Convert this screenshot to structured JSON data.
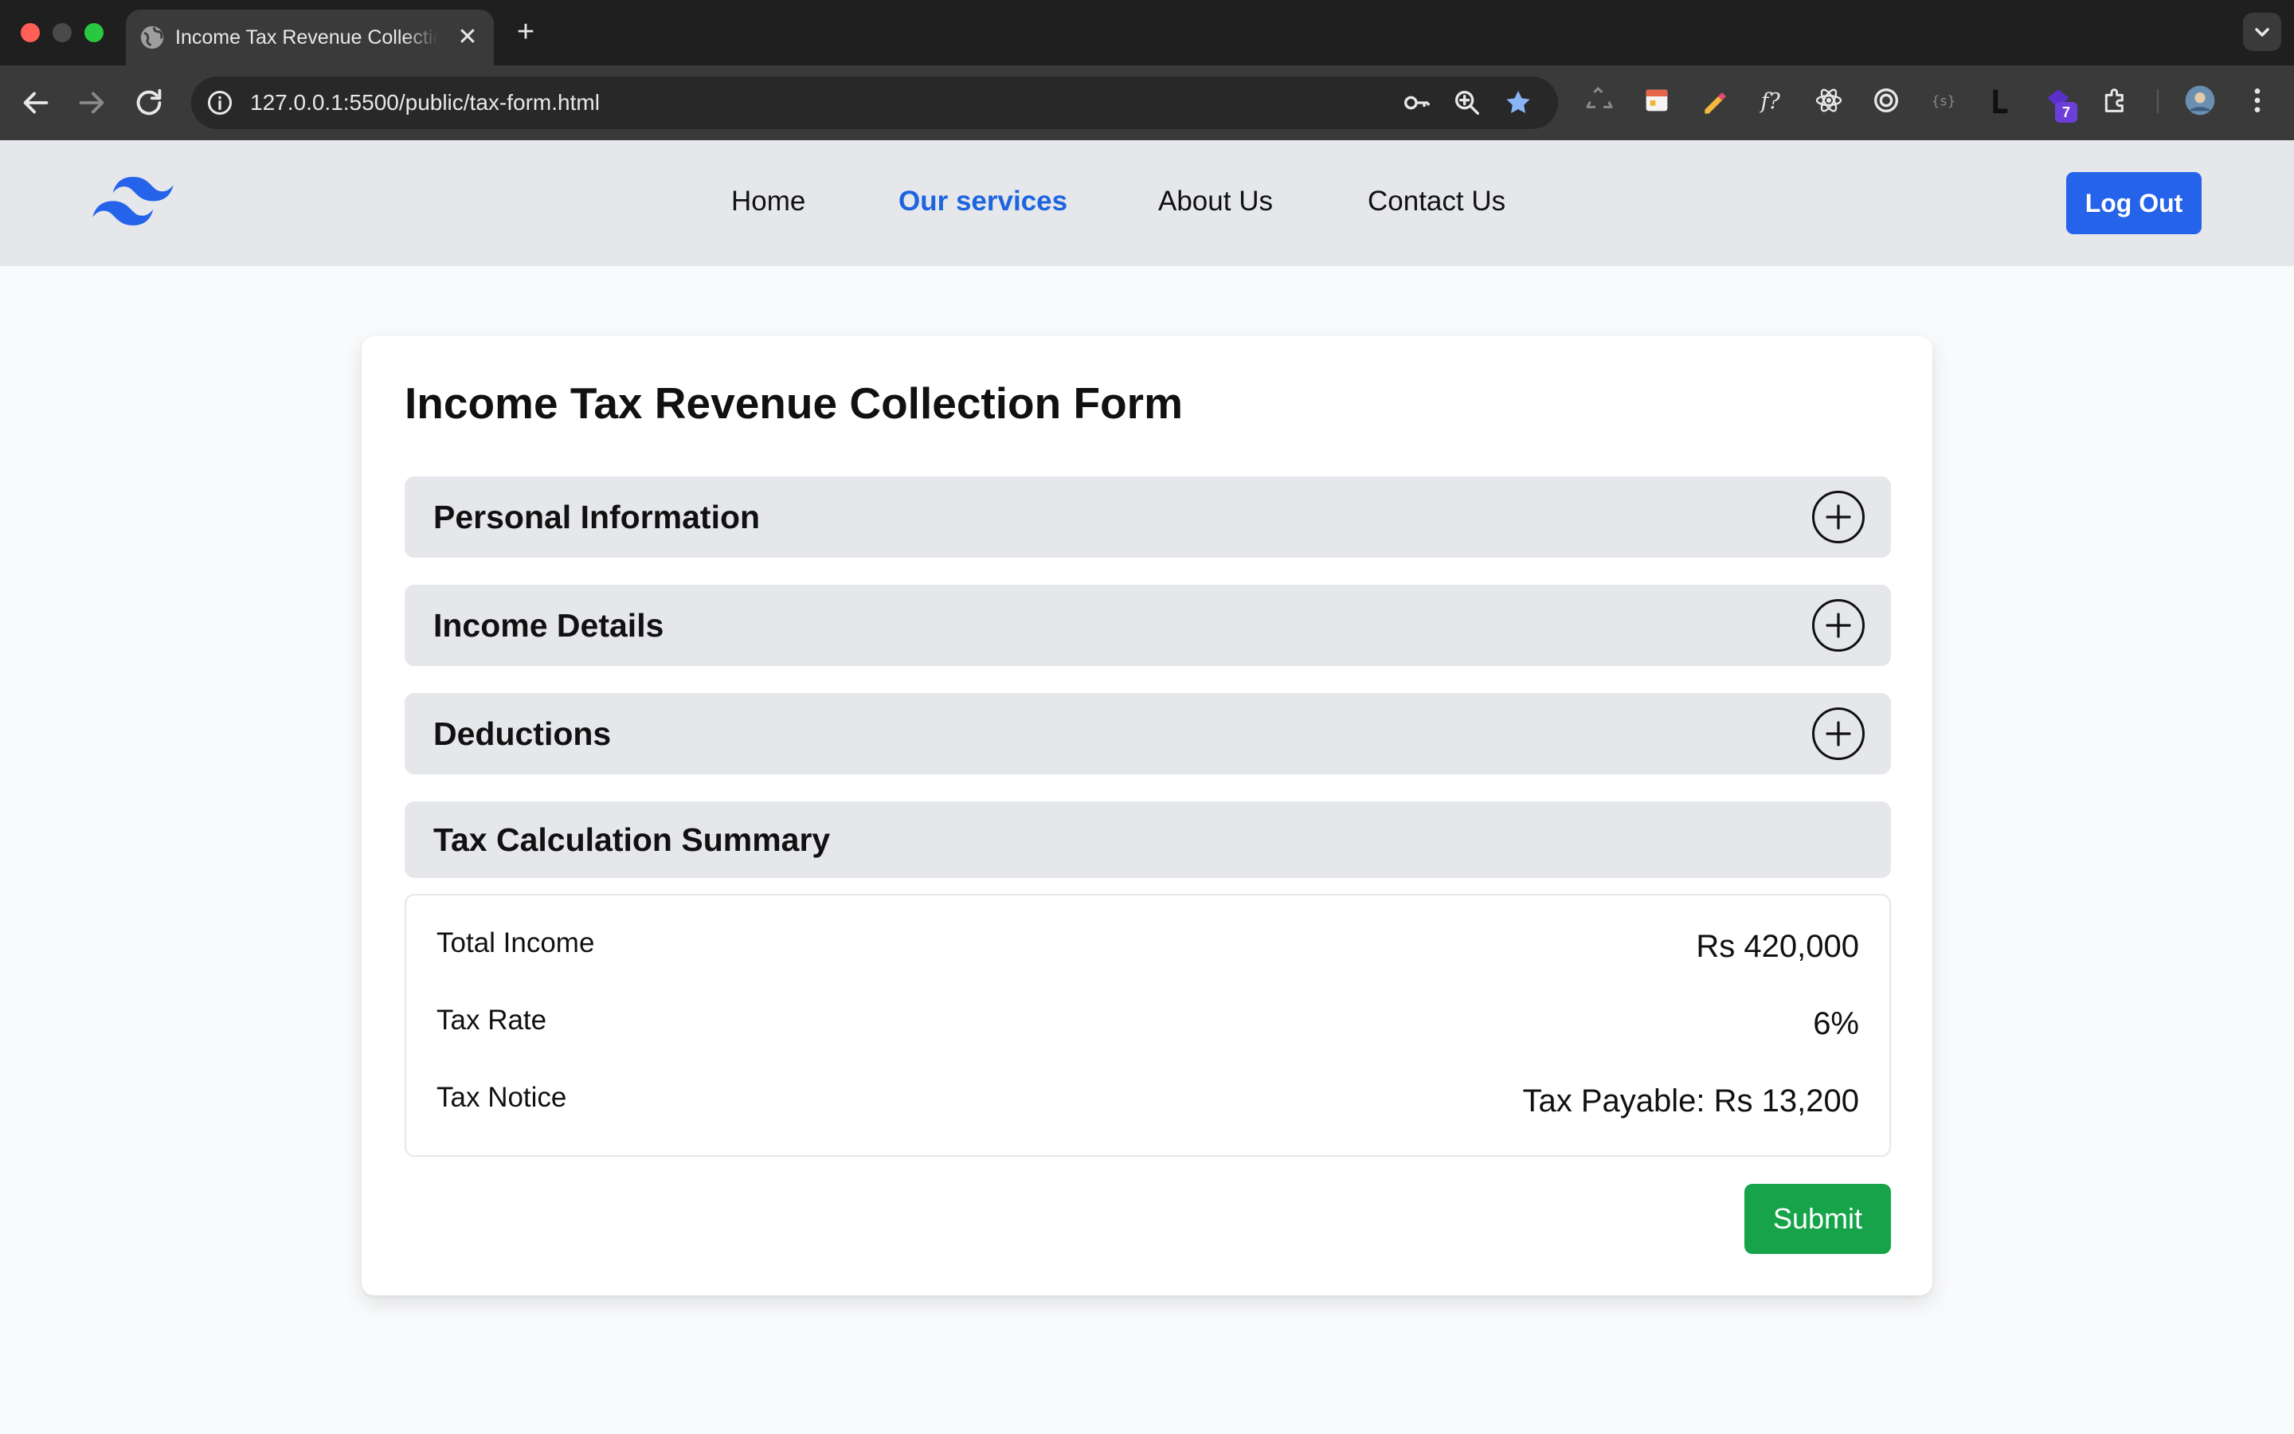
{
  "browser": {
    "tab_title": "Income Tax Revenue Collection Form",
    "url": "127.0.0.1:5500/public/tax-form.html",
    "extension_badge": "7"
  },
  "nav": {
    "links": [
      {
        "label": "Home",
        "active": false
      },
      {
        "label": "Our services",
        "active": true
      },
      {
        "label": "About Us",
        "active": false
      },
      {
        "label": "Contact Us",
        "active": false
      }
    ],
    "logout_label": "Log Out"
  },
  "form": {
    "title": "Income Tax Revenue Collection Form",
    "sections": [
      {
        "title": "Personal Information",
        "expandable": true
      },
      {
        "title": "Income Details",
        "expandable": true
      },
      {
        "title": "Deductions",
        "expandable": true
      },
      {
        "title": "Tax Calculation Summary",
        "expandable": false
      }
    ],
    "summary": [
      {
        "label": "Total Income",
        "value": "Rs 420,000"
      },
      {
        "label": "Tax Rate",
        "value": "6%"
      },
      {
        "label": "Tax Notice",
        "value": "Tax Payable: Rs 13,200"
      }
    ],
    "submit_label": "Submit"
  },
  "colors": {
    "accent_blue": "#2563eb",
    "active_link": "#1d64e0",
    "submit_green": "#16a34a",
    "section_bg": "#e5e7eb"
  }
}
